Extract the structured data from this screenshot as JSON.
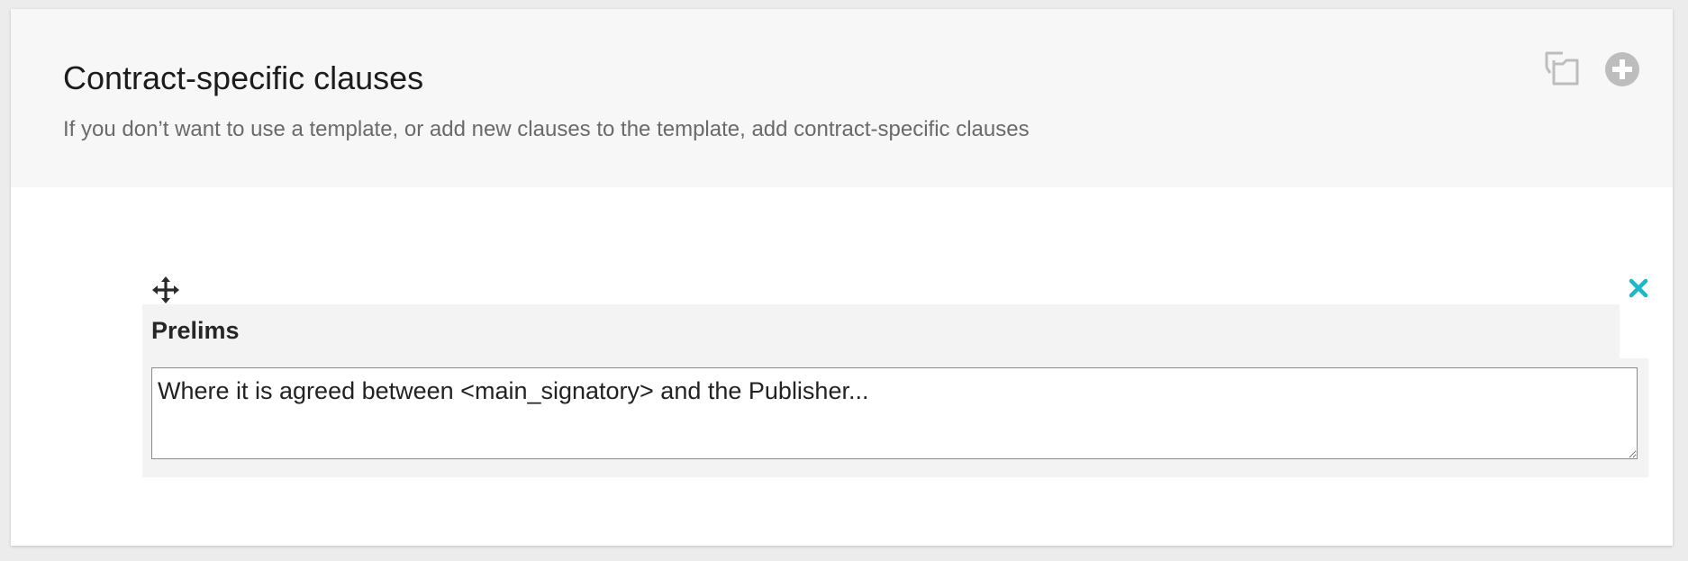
{
  "section": {
    "title": "Contract-specific clauses",
    "subtitle": "If you don’t want to use a template, or add new clauses to the template, add contract-specific clauses",
    "actions": [
      {
        "icon": "copy-icon",
        "color": "#bdbdbd"
      },
      {
        "icon": "add-circle-icon",
        "color": "#bdbdbd"
      }
    ]
  },
  "clause": {
    "title": "Prelims",
    "text": "Where it is agreed between <main_signatory> and the Publisher...",
    "drag_icon": "move-icon",
    "remove_icon": "close-icon"
  },
  "colors": {
    "accent": "#1ab8c8",
    "header_bg": "#f7f7f7",
    "clause_bg": "#f3f3f3",
    "icon_gray": "#bdbdbd"
  }
}
